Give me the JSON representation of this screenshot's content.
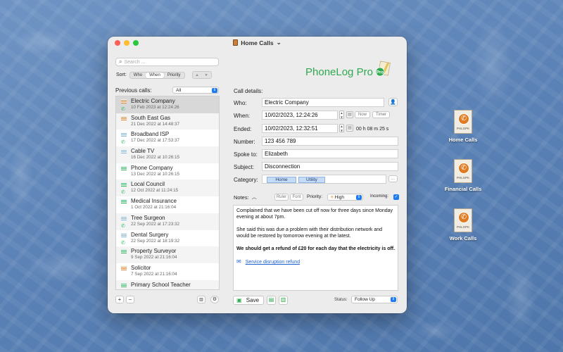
{
  "window": {
    "title": "Home Calls"
  },
  "left": {
    "search_placeholder": "Search ...",
    "sort_label": "Sort:",
    "sort_options": [
      "Who",
      "When",
      "Priority"
    ],
    "sort_selected": "When",
    "sort_direction": [
      "▵",
      "▿"
    ],
    "previous_label": "Previous calls:",
    "filter_value": "All",
    "calls": [
      {
        "name": "Electric Company",
        "date": "10 Feb 2023 at 12:24:26",
        "color": "orange",
        "phone": true,
        "selected": true
      },
      {
        "name": "South East Gas",
        "date": "21 Dec 2022 at 14:48:37",
        "color": "orange",
        "phone": false
      },
      {
        "name": "Broadband ISP",
        "date": "17 Dec 2022 at 17:53:37",
        "color": "blue",
        "phone": true
      },
      {
        "name": "Cable TV",
        "date": "16 Dec 2022 at 10:26:15",
        "color": "blue",
        "phone": false
      },
      {
        "name": "Phone Company",
        "date": "13 Dec 2022 at 10:26:15",
        "color": "green",
        "phone": false
      },
      {
        "name": "Local Council",
        "date": "12 Oct 2022 at 11:24:15",
        "color": "green",
        "phone": true
      },
      {
        "name": "Medical Insurance",
        "date": "1 Oct 2022 at 21:16:04",
        "color": "green",
        "phone": false
      },
      {
        "name": "Tree Surgeon",
        "date": "22 Sep 2022 at 17:23:32",
        "color": "blue",
        "phone": true
      },
      {
        "name": "Dental Surgery",
        "date": "22 Sep 2022 at 18:19:32",
        "color": "blue",
        "phone": true
      },
      {
        "name": "Property Surveyor",
        "date": "9 Sep 2022 at 21:16:04",
        "color": "green",
        "phone": false
      },
      {
        "name": "Solicitor",
        "date": "7 Sep 2022 at 21:16:04",
        "color": "orange",
        "phone": false
      },
      {
        "name": "Primary School Teacher",
        "date": "",
        "color": "green",
        "phone": false
      }
    ],
    "add": "+",
    "remove": "−"
  },
  "right": {
    "logo_text": "PhoneLog Pro",
    "details_label": "Call details:",
    "who_label": "Who:",
    "who_value": "Electric Company",
    "when_label": "When:",
    "when_value": "10/02/2023, 12:24:26",
    "now_label": "Now",
    "timer_label": "Timer",
    "ended_label": "Ended:",
    "ended_value": "10/02/2023, 12:32:51",
    "duration": "00 h 08 m  25 s",
    "number_label": "Number:",
    "number_value": "123 456 789",
    "spoke_label": "Spoke to:",
    "spoke_value": "Elizabeth",
    "subject_label": "Subject:",
    "subject_value": "Disconnection",
    "category_label": "Category:",
    "categories": [
      "Home",
      "Utility"
    ],
    "category_more": "...",
    "notes_label": "Notes:",
    "ruler_label": "Ruler",
    "font_label": "Font",
    "priority_label": "Priority:",
    "priority_value": "High",
    "incoming_label": "Incoming:",
    "notes": {
      "p1": "Complained that we have been cut off now for three days since Monday evening at about 7pm.",
      "p2": "She said this was due a problem with their distribution network and would be restored by tomorrow evening at the latest.",
      "p3": "We should get a refund of £20 for each day that the electricity is off.",
      "link": "Service disruption refund"
    },
    "save_label": "Save",
    "status_label": "Status:",
    "status_value": "Follow Up"
  },
  "desktop": {
    "icons": [
      {
        "label": "Home Calls",
        "ext": "PHLGPK"
      },
      {
        "label": "Financial Calls",
        "ext": "PHLGPK"
      },
      {
        "label": "Work Calls",
        "ext": "PHLGPK"
      }
    ]
  },
  "colors": {
    "accent": "#1e7cf2",
    "brand": "#2fa84f",
    "orange": "#e08a3a",
    "green": "#3bb86a",
    "blue": "#8bb6e0"
  }
}
